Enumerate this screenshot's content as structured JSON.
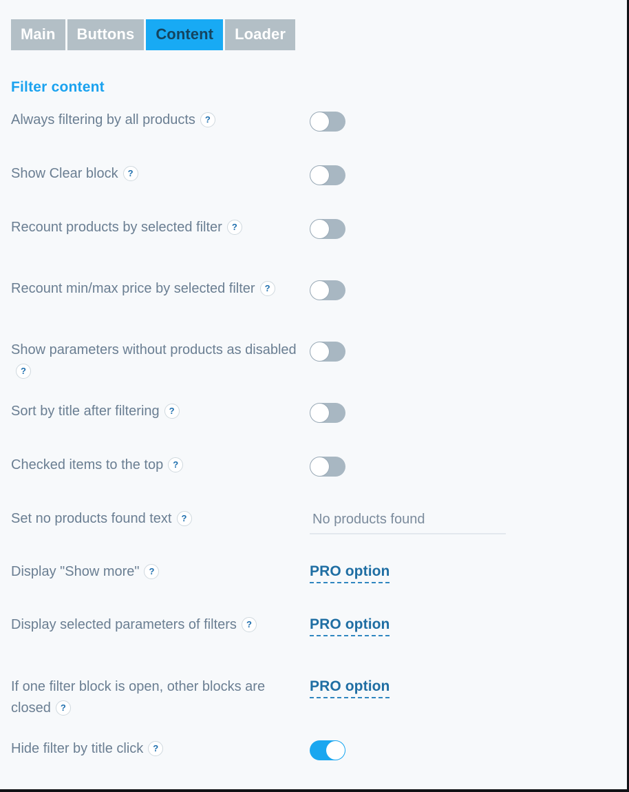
{
  "tabs": [
    {
      "label": "Main",
      "active": false
    },
    {
      "label": "Buttons",
      "active": false
    },
    {
      "label": "Content",
      "active": true
    },
    {
      "label": "Loader",
      "active": false
    }
  ],
  "section": {
    "title": "Filter content"
  },
  "colors": {
    "accent_blue": "#18aaf4",
    "heading_blue": "#1aa2ef",
    "tab_inactive": "#b3bfc6",
    "tab_active_text": "#14445f",
    "label_text": "#6a7e92",
    "toggle_off_track": "#a8b7c2",
    "toggle_on_track": "#1aa7f0",
    "pro_link": "#1f6ea3",
    "page_background": "#f7f9fb"
  },
  "help_icon": {
    "glyph": "?",
    "name": "help-icon"
  },
  "rows": [
    {
      "label": "Always filtering by all products",
      "control": "toggle",
      "value": "off"
    },
    {
      "label": "Show Clear block",
      "control": "toggle",
      "value": "off"
    },
    {
      "label": "Recount products by selected filter",
      "control": "toggle",
      "value": "off"
    },
    {
      "label": "Recount min/max price by selected filter",
      "control": "toggle",
      "value": "off"
    },
    {
      "label": "Show parameters without products as disabled",
      "control": "toggle",
      "value": "off"
    },
    {
      "label": "Sort by title after filtering",
      "control": "toggle",
      "value": "off"
    },
    {
      "label": "Checked items to the top",
      "control": "toggle",
      "value": "off"
    },
    {
      "label": "Set no products found text",
      "control": "input",
      "value": "No products found",
      "placeholder": "No products found"
    },
    {
      "label": "Display \"Show more\"",
      "control": "pro",
      "value": "PRO option"
    },
    {
      "label": "Display selected parameters of filters",
      "control": "pro",
      "value": "PRO option"
    },
    {
      "label": "If one filter block is open, other blocks are closed",
      "control": "pro",
      "value": "PRO option"
    },
    {
      "label": "Hide filter by title click",
      "control": "toggle",
      "value": "on"
    }
  ]
}
